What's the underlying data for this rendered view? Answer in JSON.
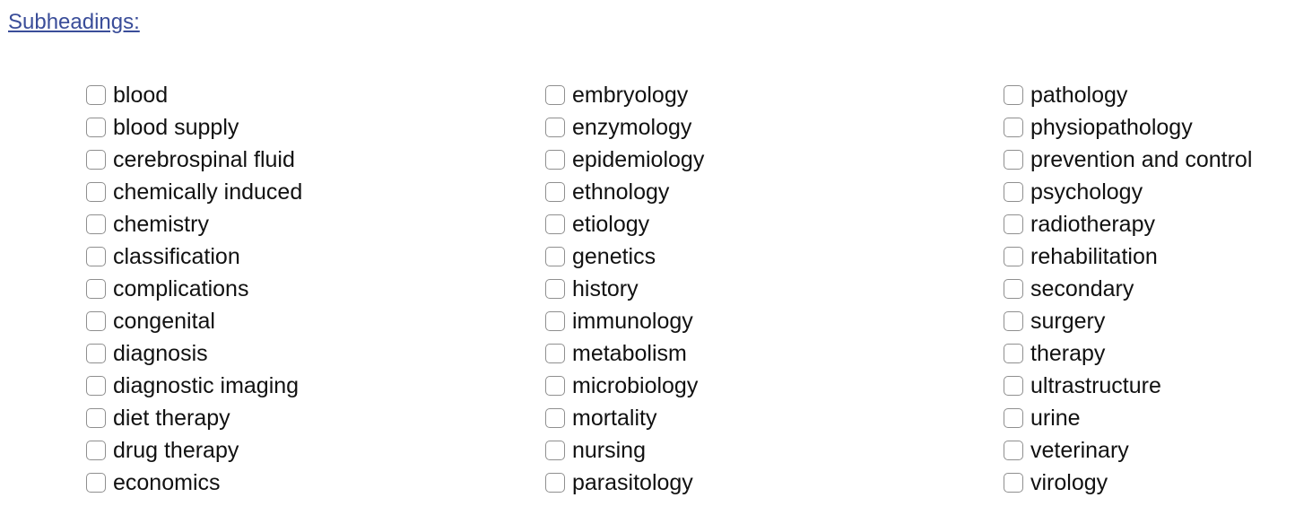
{
  "heading": {
    "label": "Subheadings:"
  },
  "columns": [
    [
      "blood",
      "blood supply",
      "cerebrospinal fluid",
      "chemically induced",
      "chemistry",
      "classification",
      "complications",
      "congenital",
      "diagnosis",
      "diagnostic imaging",
      "diet therapy",
      "drug therapy",
      "economics"
    ],
    [
      "embryology",
      "enzymology",
      "epidemiology",
      "ethnology",
      "etiology",
      "genetics",
      "history",
      "immunology",
      "metabolism",
      "microbiology",
      "mortality",
      "nursing",
      "parasitology"
    ],
    [
      "pathology",
      "physiopathology",
      "prevention and control",
      "psychology",
      "radiotherapy",
      "rehabilitation",
      "secondary",
      "surgery",
      "therapy",
      "ultrastructure",
      "urine",
      "veterinary",
      "virology"
    ]
  ]
}
